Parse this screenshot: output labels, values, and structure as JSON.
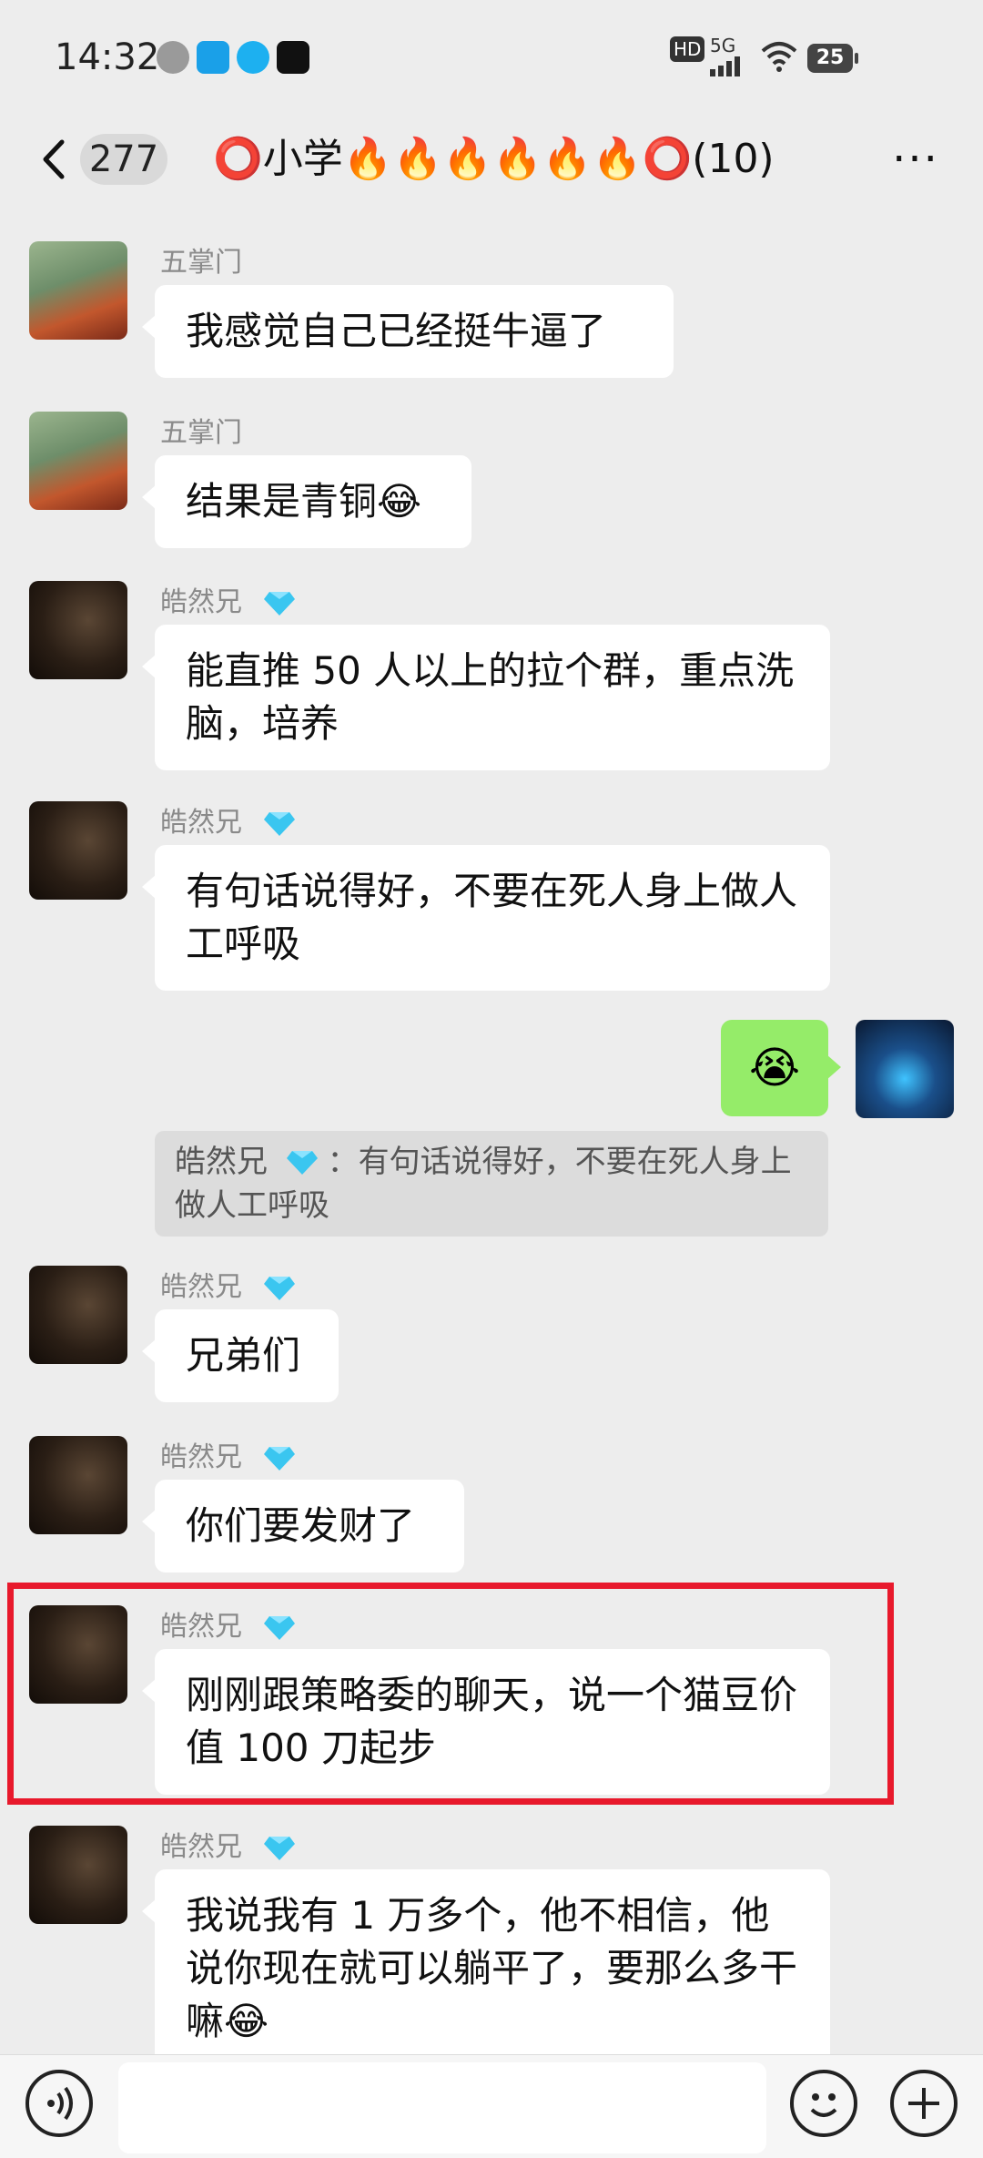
{
  "status_bar": {
    "time": "14:32",
    "network": "5G",
    "hd": "HD",
    "battery": "25",
    "app_icons": [
      "wechat-icon",
      "app-blue-icon",
      "qq-icon",
      "tiktok-icon"
    ]
  },
  "header": {
    "back_count": "277",
    "title": "⭕小学🔥🔥🔥🔥🔥🔥⭕(10)",
    "more": "···"
  },
  "messages": [
    {
      "sender": "五掌门",
      "text": "我感觉自己已经挺牛逼了",
      "avatar": "monk-avatar"
    },
    {
      "sender": "五掌门",
      "text": "结果是青铜😂",
      "avatar": "monk-avatar"
    },
    {
      "sender": "皓然兄",
      "text": "能直推 50 人以上的拉个群，重点洗脑，培养",
      "avatar": "man-avatar"
    },
    {
      "sender": "皓然兄",
      "text": "有句话说得好，不要在死人身上做人工呼吸",
      "avatar": "man-avatar"
    },
    {
      "sender": "self",
      "text": "😭",
      "avatar": "car-avatar"
    },
    {
      "sender": "皓然兄",
      "text": "兄弟们",
      "avatar": "man-avatar"
    },
    {
      "sender": "皓然兄",
      "text": "你们要发财了",
      "avatar": "man-avatar"
    },
    {
      "sender": "皓然兄",
      "text": "刚刚跟策略委的聊天，说一个猫豆价值 100 刀起步",
      "avatar": "man-avatar"
    },
    {
      "sender": "皓然兄",
      "text": "我说我有 1 万多个，他不相信，他说你现在就可以躺平了，要那么多干嘛😂",
      "avatar": "man-avatar"
    }
  ],
  "quote": {
    "sender": "皓然兄",
    "text": "：有句话说得好，不要在死人身上做人工呼吸"
  },
  "bottom_bar": {
    "voice_icon": "voice-icon",
    "emoji_icon": "emoji-icon",
    "plus_icon": "plus-icon"
  },
  "colors": {
    "background": "#ededed",
    "bubble_white": "#ffffff",
    "bubble_green": "#95ec69",
    "highlight_red": "#e8192c",
    "name_gray": "#8a8a8a"
  }
}
